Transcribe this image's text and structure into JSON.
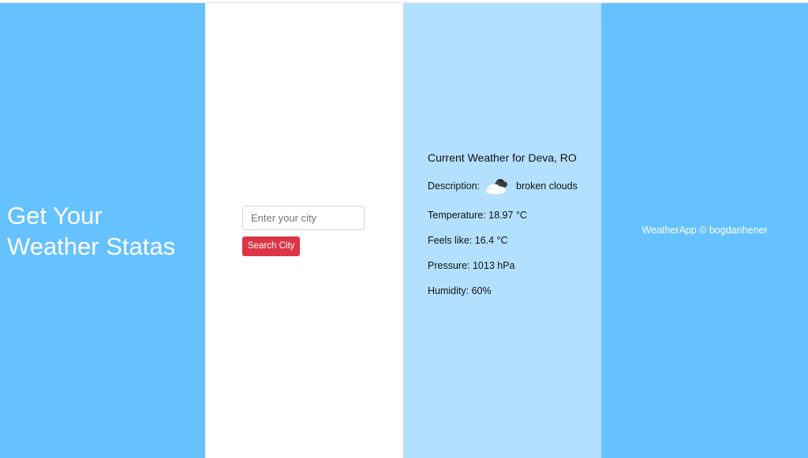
{
  "hero": {
    "title_line1": "Get Your",
    "title_line2": "Weather Statas"
  },
  "search": {
    "placeholder": "Enter your city",
    "value": "",
    "button_label": "Search City"
  },
  "weather": {
    "heading": "Current Weather for Deva, RO",
    "description_label": "Description:",
    "description_icon": "broken-clouds-icon",
    "description_value": "broken clouds",
    "temperature": "Temperature: 18.97 °C",
    "feels_like": "Feels like: 16.4 °C",
    "pressure": "Pressure: 1013 hPa",
    "humidity": "Humidity: 60%"
  },
  "footer": {
    "text": "WeatherApp © bogdanhener"
  },
  "colors": {
    "primary_blue": "#66c2ff",
    "light_blue": "#b3e0ff",
    "danger_red": "#dc3545"
  }
}
